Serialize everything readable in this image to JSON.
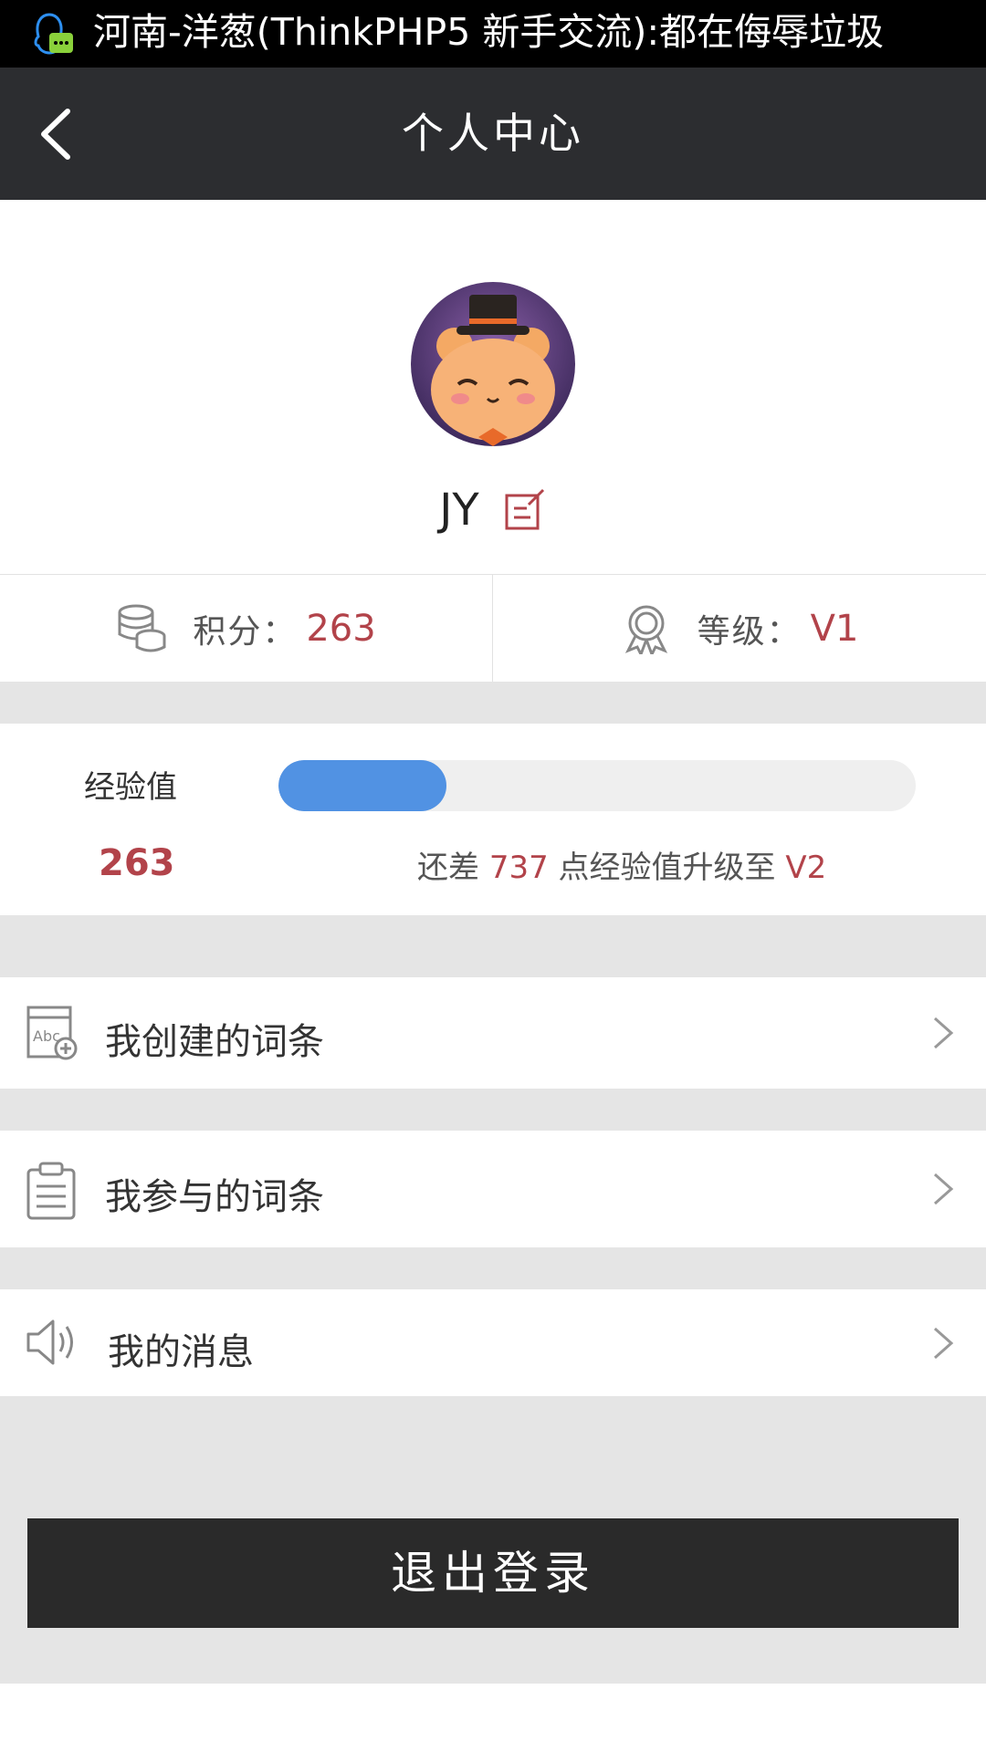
{
  "notification": {
    "text": "河南-洋葱(ThinkPHP5 新手交流):都在侮辱垃圾",
    "icon": "qq-icon"
  },
  "header": {
    "title": "个人中心",
    "back_icon": "chevron-left-icon"
  },
  "profile": {
    "username": "JY",
    "avatar_icon": "bear-avatar",
    "edit_icon": "edit-icon"
  },
  "stats": {
    "points_label": "积分：",
    "points_value": "263",
    "level_label": "等级：",
    "level_value": "V1"
  },
  "experience": {
    "label": "经验值",
    "value": "263",
    "progress_fraction": 0.263,
    "hint_prefix": "还差",
    "hint_amount": "737",
    "hint_middle": "点经验值升级至",
    "hint_level": "V2"
  },
  "menu": [
    {
      "label": "我创建的词条",
      "icon": "dictionary-add-icon"
    },
    {
      "label": "我参与的词条",
      "icon": "clipboard-icon"
    },
    {
      "label": "我的消息",
      "icon": "speaker-icon"
    }
  ],
  "logout_label": "退出登录",
  "colors": {
    "accent_red": "#b2434a",
    "progress_blue": "#5192e3",
    "header_bg": "#2c2d30",
    "separator": "#e5e5e5"
  }
}
